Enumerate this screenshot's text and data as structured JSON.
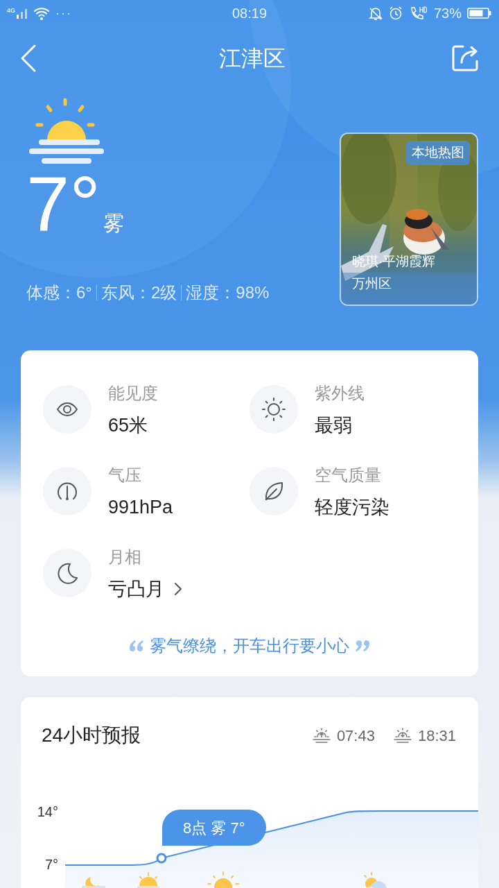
{
  "status_bar": {
    "network": "4G",
    "more": "···",
    "time": "08:19",
    "battery_percent": "73%"
  },
  "header": {
    "title": "江津区"
  },
  "current": {
    "temperature": "7°",
    "condition": "雾",
    "details": [
      "体感：6°",
      "东风：2级",
      "湿度：98%"
    ]
  },
  "photo_card": {
    "badge": "本地热图",
    "caption": "晓琪·平湖霞辉",
    "location": "万州区"
  },
  "indices": [
    {
      "kind": "eye",
      "label": "能见度",
      "value": "65米",
      "has_arrow": false
    },
    {
      "kind": "sun",
      "label": "紫外线",
      "value": "最弱",
      "has_arrow": false
    },
    {
      "kind": "gauge",
      "label": "气压",
      "value": "991hPa",
      "has_arrow": false
    },
    {
      "kind": "leaf",
      "label": "空气质量",
      "value": "轻度污染",
      "has_arrow": false
    },
    {
      "kind": "moon",
      "label": "月相",
      "value": "亏凸月",
      "has_arrow": true
    }
  ],
  "tip": "雾气缭绕，开车出行要小心",
  "forecast": {
    "title": "24小时预报",
    "sunrise": "07:43",
    "sunset": "18:31",
    "tooltip": "8点 雾 7°",
    "icons": [
      {
        "kind": "moon"
      },
      {
        "kind": "sunrise"
      },
      {
        "kind": "sun"
      },
      {
        "kind": "partly_cloudy"
      }
    ],
    "y_labels": [
      "14°",
      "7°"
    ]
  }
}
